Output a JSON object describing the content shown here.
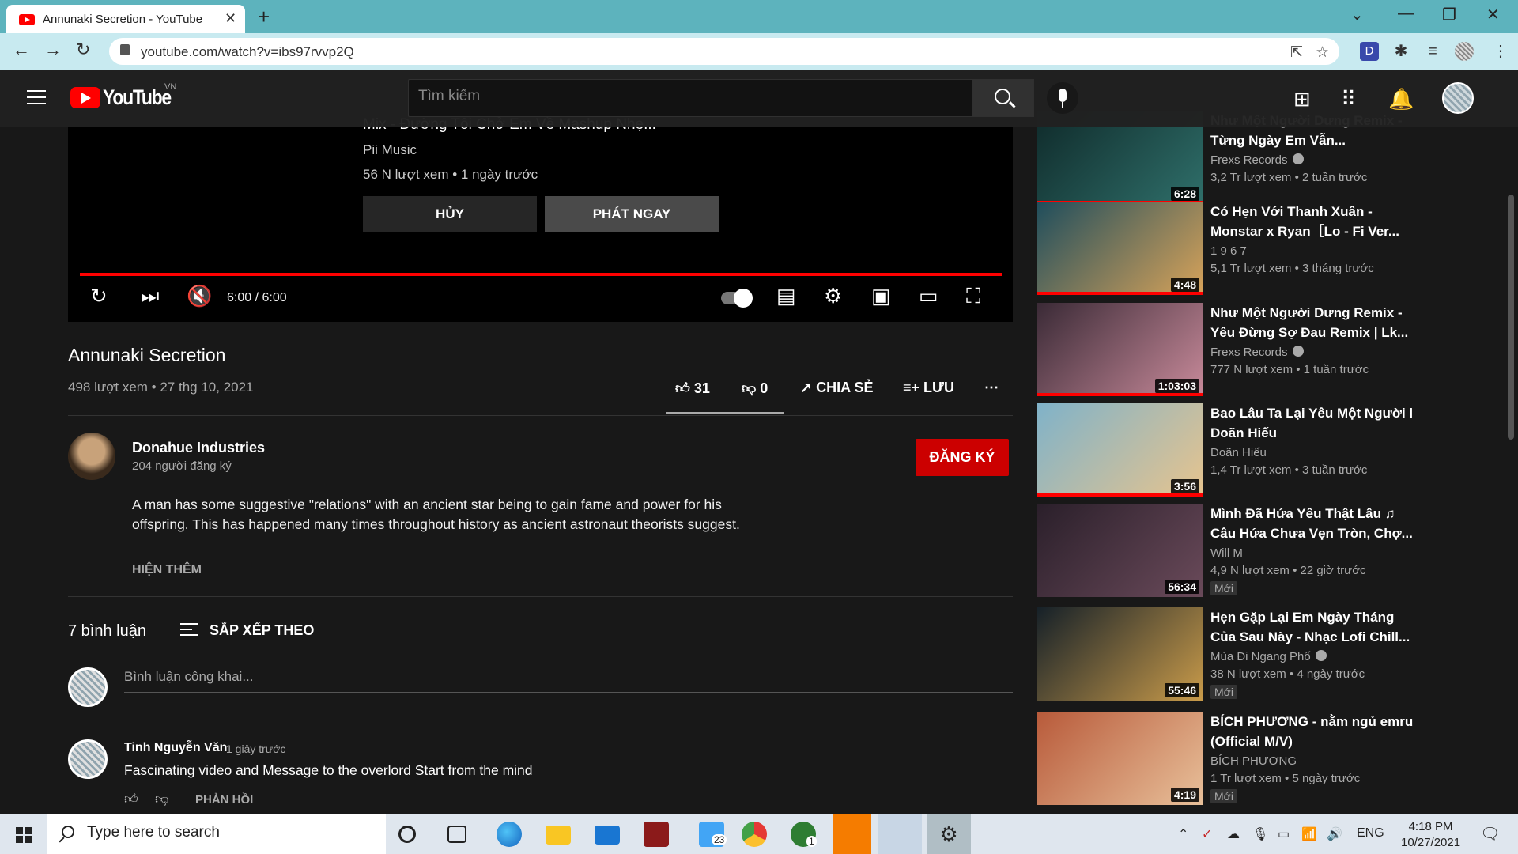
{
  "browser": {
    "tab_title": "Annunaki Secretion - YouTube",
    "url": "youtube.com/watch?v=ibs97rvvp2Q",
    "extensions": [
      "D"
    ]
  },
  "masthead": {
    "logo_text": "YouTube",
    "country_code": "VN",
    "search_placeholder": "Tìm kiếm"
  },
  "player": {
    "upnext_title": "Mix - Đường Tôi Chở Em Về Mashup Nhẹ...",
    "upnext_channel": "Pii Music",
    "upnext_meta": "56 N lượt xem • 1 ngày trước",
    "cancel_label": "HỦY",
    "play_now_label": "PHÁT NGAY",
    "timecode": "6:00 / 6:00",
    "progress": 1.0
  },
  "video": {
    "title": "Annunaki Secretion",
    "meta": "498 lượt xem • 27 thg 10, 2021",
    "likes": "31",
    "dislikes": "0",
    "share_label": "CHIA SẺ",
    "save_label": "LƯU"
  },
  "channel": {
    "name": "Donahue Industries",
    "subs": "204 người đăng ký",
    "subscribe_label": "ĐĂNG KÝ",
    "description": "A man has some suggestive \"relations\" with an ancient star being to gain fame and power for his offspring. This has happened many times throughout history as ancient astronaut theorists suggest.",
    "show_more": "HIỆN THÊM"
  },
  "comments": {
    "count_label": "7 bình luận",
    "sort_label": "SẮP XẾP THEO",
    "input_placeholder": "Bình luận công khai...",
    "items": [
      {
        "author": "Tinh Nguyễn Văn",
        "time": "1 giây trước",
        "text": "Fascinating video and Message to the overlord Start from the mind",
        "reply_label": "PHẢN HỒI"
      }
    ]
  },
  "sidebar": {
    "items": [
      {
        "title": "Như Một Người Dưng Remix - Từng Ngày Em Vẫn...",
        "channel": "Frexs Records",
        "verified": true,
        "meta": "3,2 Tr lượt xem • 2 tuần trước",
        "duration": "6:28",
        "colors": [
          "#0f2a2a",
          "#2f6f6a"
        ]
      },
      {
        "title": "Có Hẹn Với Thanh Xuân - Monstar x Ryan［Lo - Fi Ver...",
        "channel": "1 9 6 7",
        "verified": false,
        "meta": "5,1 Tr lượt xem • 3 tháng trước",
        "duration": "4:48",
        "colors": [
          "#1e4d5c",
          "#d8a35a"
        ]
      },
      {
        "title": "Như Một Người Dưng Remix - Yêu Đừng Sợ Đau Remix | Lk...",
        "channel": "Frexs Records",
        "verified": true,
        "meta": "777 N lượt xem • 1 tuần trước",
        "duration": "1:03:03",
        "colors": [
          "#3a2a36",
          "#c88a9a"
        ]
      },
      {
        "title": "Bao Lâu Ta Lại Yêu Một Người l Doãn Hiếu",
        "channel": "Doãn Hiếu",
        "verified": false,
        "meta": "1,4 Tr lượt xem • 3 tuần trước",
        "duration": "3:56",
        "colors": [
          "#7fb2c9",
          "#e7c48e"
        ]
      },
      {
        "title": "Mình Đã Hứa Yêu Thật Lâu ♫ Câu Hứa Chưa Vẹn Tròn, Chợ...",
        "channel": "Will M",
        "verified": false,
        "meta": "4,9 N lượt xem • 22 giờ trước",
        "duration": "56:34",
        "new_label": "Mới",
        "colors": [
          "#2a1f2a",
          "#6a4a5a"
        ]
      },
      {
        "title": "Hẹn Gặp Lại Em Ngày Tháng Của Sau Này - Nhạc Lofi Chill...",
        "channel": "Mùa Đi Ngang Phố",
        "verified": true,
        "meta": "38 N lượt xem • 4 ngày trước",
        "duration": "55:46",
        "new_label": "Mới",
        "colors": [
          "#152028",
          "#c99b4a"
        ]
      },
      {
        "title": "BÍCH PHƯƠNG - nằm ngủ emru (Official M/V)",
        "channel": "BÍCH PHƯƠNG",
        "verified": false,
        "meta": "1 Tr lượt xem • 5 ngày trước",
        "duration": "4:19",
        "new_label": "Mới",
        "colors": [
          "#b85a3a",
          "#e8c09a"
        ]
      }
    ]
  },
  "taskbar": {
    "search_placeholder": "Type here to search",
    "time": "4:18 PM",
    "date": "10/27/2021",
    "language": "ENG",
    "badge_count": "23",
    "xbox_badge": "1"
  }
}
